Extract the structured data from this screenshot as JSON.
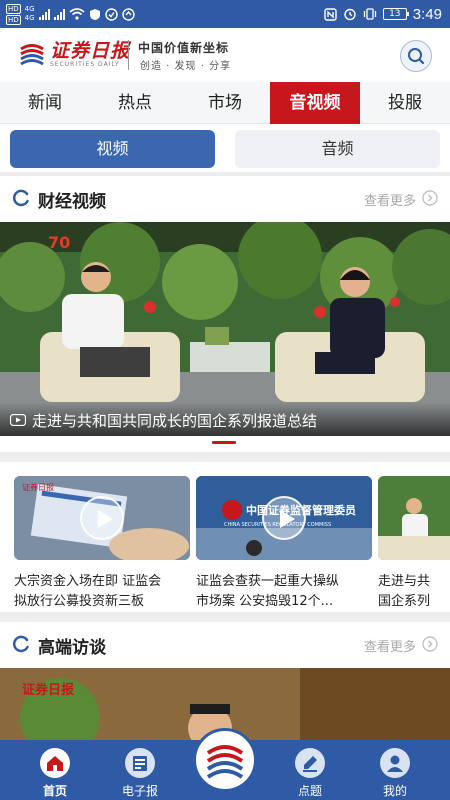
{
  "status_bar": {
    "left_labels": [
      "HD",
      "4G",
      "HD",
      "4G"
    ],
    "battery": "13",
    "time": "3:49"
  },
  "header": {
    "logo_cn": "证券日报",
    "logo_en": "SECURITIES DAILY",
    "slogan_main": "中国价值新坐标",
    "slogan_sub": "创造 · 发现 · 分享",
    "search_icon": "search-icon"
  },
  "nav_tabs": [
    {
      "label": "新闻"
    },
    {
      "label": "热点"
    },
    {
      "label": "市场"
    },
    {
      "label": "音视频",
      "active": true
    },
    {
      "label": "投服"
    }
  ],
  "media_switch": {
    "video": "视频",
    "audio": "音频",
    "active": "video"
  },
  "sections": [
    {
      "title": "财经视频",
      "more": "查看更多"
    },
    {
      "title": "高端访谈",
      "more": "查看更多"
    }
  ],
  "hero": {
    "caption": "走进与共和国共同成长的国企系列报道总结",
    "slides_active": 1
  },
  "video_cards": [
    {
      "title_line1": "大宗资金入场在即 证监会",
      "title_line2": "拟放行公募投资新三板"
    },
    {
      "title_line1": "证监会查获一起重大操纵",
      "title_line2": "市场案 公安捣毁12个..."
    },
    {
      "title_line1": "走进与共",
      "title_line2": "国企系列"
    }
  ],
  "thumb_text": {
    "csrc_cn": "中国证券监督管理委员",
    "csrc_en": "CHINA SECURITIES REGULATORY COMMISS"
  },
  "tab_bar": {
    "items": [
      {
        "label": "首页",
        "icon": "home-icon",
        "active": true
      },
      {
        "label": "电子报",
        "icon": "newspaper-icon"
      },
      {
        "label": "",
        "icon": "logo-icon"
      },
      {
        "label": "点题",
        "icon": "topic-icon"
      },
      {
        "label": "我的",
        "icon": "profile-icon"
      }
    ]
  },
  "colors": {
    "brand_blue": "#2f5aa6",
    "brand_red": "#c8161d",
    "segment_active": "#3a67b0"
  }
}
